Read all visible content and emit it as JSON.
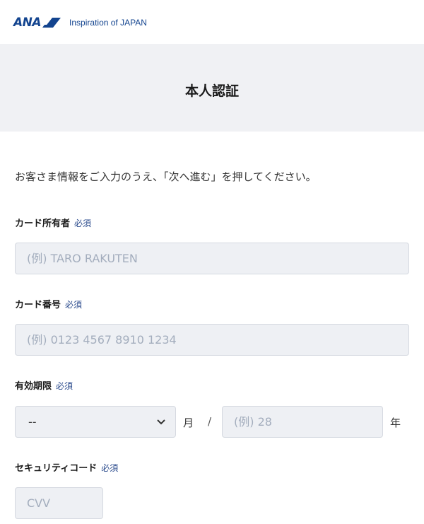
{
  "header": {
    "logo_text": "ANA",
    "tagline": "Inspiration of JAPAN"
  },
  "title": "本人認証",
  "instruction": "お客さま情報をご入力のうえ、「次へ進む」を押してください。",
  "required_label": "必須",
  "fields": {
    "card_holder": {
      "label": "カード所有者",
      "placeholder": "(例) TARO RAKUTEN",
      "value": ""
    },
    "card_number": {
      "label": "カード番号",
      "placeholder": "(例) 0123 4567 8910 1234",
      "value": ""
    },
    "expiry": {
      "label": "有効期限",
      "month_selected": "--",
      "month_unit": "月",
      "separator": "/",
      "year_placeholder": "(例) 28",
      "year_unit": "年"
    },
    "security_code": {
      "label": "セキュリティコード",
      "placeholder": "CVV",
      "value": ""
    }
  },
  "icons": {
    "logo_mark": "ana-logo-mark",
    "select_arrow": "chevron-down-icon"
  },
  "colors": {
    "brand_blue": "#13448f",
    "band_background": "#f0f1f4",
    "input_background": "#eef0f4",
    "placeholder": "#a3adbd",
    "required_text": "#2a4a8c"
  }
}
